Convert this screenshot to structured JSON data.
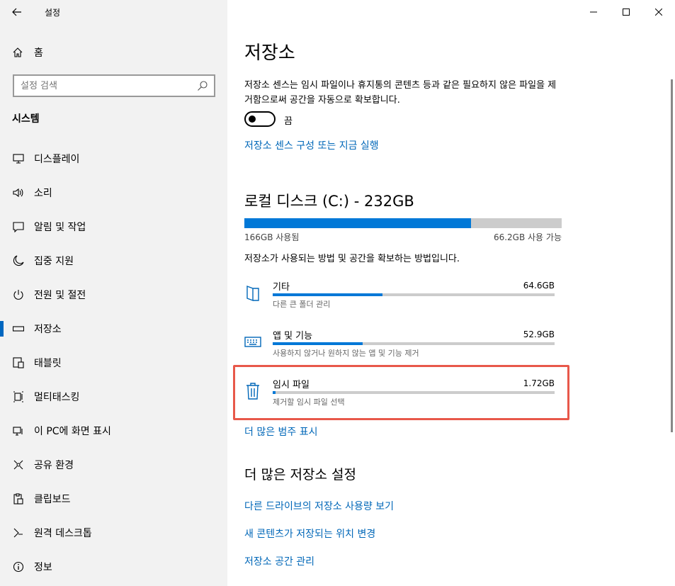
{
  "app": {
    "title": "설정"
  },
  "sidebar": {
    "home_label": "홈",
    "search_placeholder": "설정 검색",
    "section_title": "시스템",
    "items": [
      {
        "label": "디스플레이",
        "icon": "monitor-icon"
      },
      {
        "label": "소리",
        "icon": "speaker-icon"
      },
      {
        "label": "알림 및 작업",
        "icon": "message-icon"
      },
      {
        "label": "집중 지원",
        "icon": "moon-icon"
      },
      {
        "label": "전원 및 절전",
        "icon": "power-icon"
      },
      {
        "label": "저장소",
        "icon": "storage-icon",
        "selected": true
      },
      {
        "label": "태블릿",
        "icon": "tablet-icon"
      },
      {
        "label": "멀티태스킹",
        "icon": "multitask-icon"
      },
      {
        "label": "이 PC에 화면 표시",
        "icon": "project-icon"
      },
      {
        "label": "공유 환경",
        "icon": "share-icon"
      },
      {
        "label": "클립보드",
        "icon": "clipboard-icon"
      },
      {
        "label": "원격 데스크톱",
        "icon": "remote-icon"
      },
      {
        "label": "정보",
        "icon": "info-icon"
      }
    ]
  },
  "main": {
    "title": "저장소",
    "description": "저장소 센스는 임시 파일이나 휴지통의 콘텐츠 등과 같은 필요하지 않은 파일을 제거함으로써 공간을 자동으로 확보합니다.",
    "toggle_state": "끔",
    "toggle_on": false,
    "configure_link": "저장소 센스 구성 또는 지금 실행",
    "drive": {
      "title": "로컬 디스크 (C:) - 232GB",
      "used_label": "166GB 사용됨",
      "free_label": "66.2GB 사용 가능",
      "used_fraction": 0.715
    },
    "how_label": "저장소가 사용되는 방법 및 공간을 확보하는 방법입니다.",
    "categories": [
      {
        "name": "기타",
        "size": "64.6GB",
        "sub": "다른 큰 폴더 관리",
        "fraction": 0.39,
        "icon": "folder-icon"
      },
      {
        "name": "앱 및 기능",
        "size": "52.9GB",
        "sub": "사용하지 않거나 원하지 않는 앱 및 기능 제거",
        "fraction": 0.32,
        "icon": "keyboard-icon"
      },
      {
        "name": "임시 파일",
        "size": "1.72GB",
        "sub": "제거할 임시 파일 선택",
        "fraction": 0.01,
        "icon": "trash-icon"
      }
    ],
    "more_categories_link": "더 많은 범주 표시",
    "more_settings_title": "더 많은 저장소 설정",
    "links": [
      "다른 드라이브의 저장소 사용량 보기",
      "새 콘텐츠가 저장되는 위치 변경",
      "저장소 공간 관리"
    ]
  },
  "colors": {
    "accent": "#0078d7",
    "link": "#0067b8",
    "highlight": "#e8584a"
  }
}
